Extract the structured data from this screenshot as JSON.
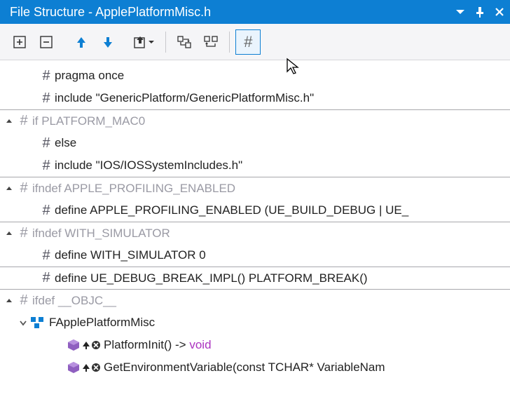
{
  "titlebar": {
    "app": "File Structure",
    "file": "ApplePlatformMisc.h"
  },
  "toolbar": {
    "expand_all": "Expand All",
    "collapse_all": "Collapse All",
    "up": "Up",
    "down": "Down",
    "export": "Export",
    "show_inherited": "Show Inherited",
    "sync": "Sync",
    "preprocessor": "#"
  },
  "rows": [
    {
      "hash": "#",
      "text": "pragma once",
      "grey": false
    },
    {
      "hash": "#",
      "text": "include \"GenericPlatform/GenericPlatformMisc.h\"",
      "grey": false
    },
    {
      "hash": "#",
      "text": "if PLATFORM_MAC0",
      "grey": true,
      "group": true
    },
    {
      "hash": "#",
      "text": "else",
      "grey": false
    },
    {
      "hash": "#",
      "text": "include \"IOS/IOSSystemIncludes.h\"",
      "grey": false
    },
    {
      "hash": "#",
      "text": "ifndef APPLE_PROFILING_ENABLED",
      "grey": true,
      "group": true
    },
    {
      "hash": "#",
      "text": "define APPLE_PROFILING_ENABLED (UE_BUILD_DEBUG | UE_",
      "grey": false
    },
    {
      "hash": "#",
      "text": "ifndef WITH_SIMULATOR",
      "grey": true,
      "group": true
    },
    {
      "hash": "#",
      "text": "define WITH_SIMULATOR 0",
      "grey": false
    },
    {
      "hash": "#",
      "text": "define UE_DEBUG_BREAK_IMPL() PLATFORM_BREAK()",
      "grey": false,
      "bbot": true
    },
    {
      "hash": "#",
      "text": "ifdef __OBJC__",
      "grey": true,
      "group": true
    }
  ],
  "class": {
    "name": "FApplePlatformMisc",
    "methods": [
      {
        "name": "PlatformInit()",
        "ret": " -> ",
        "rt": "void"
      },
      {
        "name": "GetEnvironmentVariable(const TCHAR* VariableNam",
        "ret": "",
        "rt": ""
      }
    ]
  }
}
